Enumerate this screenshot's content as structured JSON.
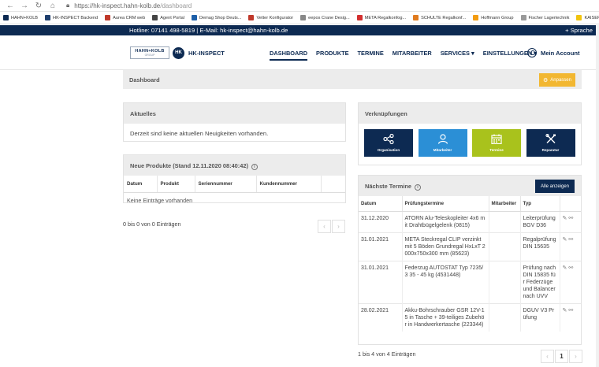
{
  "browser": {
    "url_host": "https://hk-inspect.hahn-kolb.de",
    "url_path": "/dashboard",
    "bookmarks": [
      {
        "label": "HAHN+KOLB",
        "color": "#0d2a52"
      },
      {
        "label": "HK-INSPECT Backend",
        "color": "#1f3f6e"
      },
      {
        "label": "Aurea CRM web",
        "color": "#c0392b"
      },
      {
        "label": "Agent Portal",
        "color": "#444444"
      },
      {
        "label": "Demag Shop Deuts...",
        "color": "#1d5fa8"
      },
      {
        "label": "Vetter Konfigurator",
        "color": "#c0392b"
      },
      {
        "label": "eepos Crane Desig...",
        "color": "#888888"
      },
      {
        "label": "META Regalkonfog...",
        "color": "#d32f2f"
      },
      {
        "label": "SCHULTE Regalkonf...",
        "color": "#e07b1f"
      },
      {
        "label": "Hoffmann Group",
        "color": "#f39c12"
      },
      {
        "label": "Fischer Lagertechnik",
        "color": "#999999"
      },
      {
        "label": "KAISER+KRAFT",
        "color": "#f1c40f"
      }
    ]
  },
  "topbar": {
    "hotline": "Hotline: 07141 498-5819  |  E-Mail: hk-inspect@hahn-kolb.de",
    "language": "+ Sprache"
  },
  "header": {
    "logo_line1": "HAHN+KOLB",
    "logo_line2": "GROUP",
    "logo_badge": "HK",
    "logo_text": "HK-INSPECT",
    "nav": [
      "DASHBOARD",
      "PRODUKTE",
      "TERMINE",
      "MITARBEITER",
      "SERVICES ▾",
      "EINSTELLUNGEN ▾"
    ],
    "account": "Mein Account"
  },
  "dashboard": {
    "title": "Dashboard",
    "customize": "Anpassen"
  },
  "aktuelles": {
    "title": "Aktuelles",
    "message": "Derzeit sind keine aktuellen Neuigkeiten vorhanden."
  },
  "produkte": {
    "title": "Neue Produkte (Stand 12.11.2020 08:40:42)",
    "columns": [
      "Datum",
      "Produkt",
      "Seriennummer",
      "Kundennummer",
      ""
    ],
    "empty": "Keine Einträge vorhanden",
    "count": "0 bis 0 von 0 Einträgen"
  },
  "verknuepfungen": {
    "title": "Verknüpfungen",
    "tiles": [
      {
        "label": "Organisation",
        "color": "#0d2a52",
        "icon": "share-icon"
      },
      {
        "label": "Mitarbeiter",
        "color": "#2b8fd6",
        "icon": "person-icon"
      },
      {
        "label": "Termine",
        "color": "#a9c21c",
        "icon": "calendar-icon"
      },
      {
        "label": "Reparatur",
        "color": "#0d2a52",
        "icon": "tools-icon"
      }
    ]
  },
  "termine": {
    "title": "Nächste Termine",
    "show_all": "Alle anzeigen",
    "columns": [
      "Datum",
      "Prüfungstermine",
      "Mitarbeiter",
      "Typ",
      ""
    ],
    "rows": [
      {
        "date": "31.12.2020",
        "product": "ATORN Alu-Teleskopleiter 4x6 mit Drahtbügelgelenk (0815)",
        "employee": "",
        "type": "Leiterprüfung BGV D36"
      },
      {
        "date": "31.01.2021",
        "product": "META Steckregal CLIP verzinkt mit 5 Böden Grundregal HxLxT 2000x750x300 mm (85623)",
        "employee": "",
        "type": "Regalprüfung DIN 15635"
      },
      {
        "date": "31.01.2021",
        "product": "Federzug AUTOSTAT Typ 7235/3 35 - 45 kg (4531448)",
        "employee": "",
        "type": "Prüfung nach DIN 15835 für Federzüge und Balancer nach UVV"
      },
      {
        "date": "28.02.2021",
        "product": "Akku-Bohrschrauber GSR 12V-15 in Tasche + 39-teiliges Zubehör in Handwerkertasche (223344)",
        "employee": "",
        "type": "DGUV V3 Prüfung"
      }
    ],
    "count": "1 bis 4 von 4 Einträgen",
    "page": "1"
  }
}
